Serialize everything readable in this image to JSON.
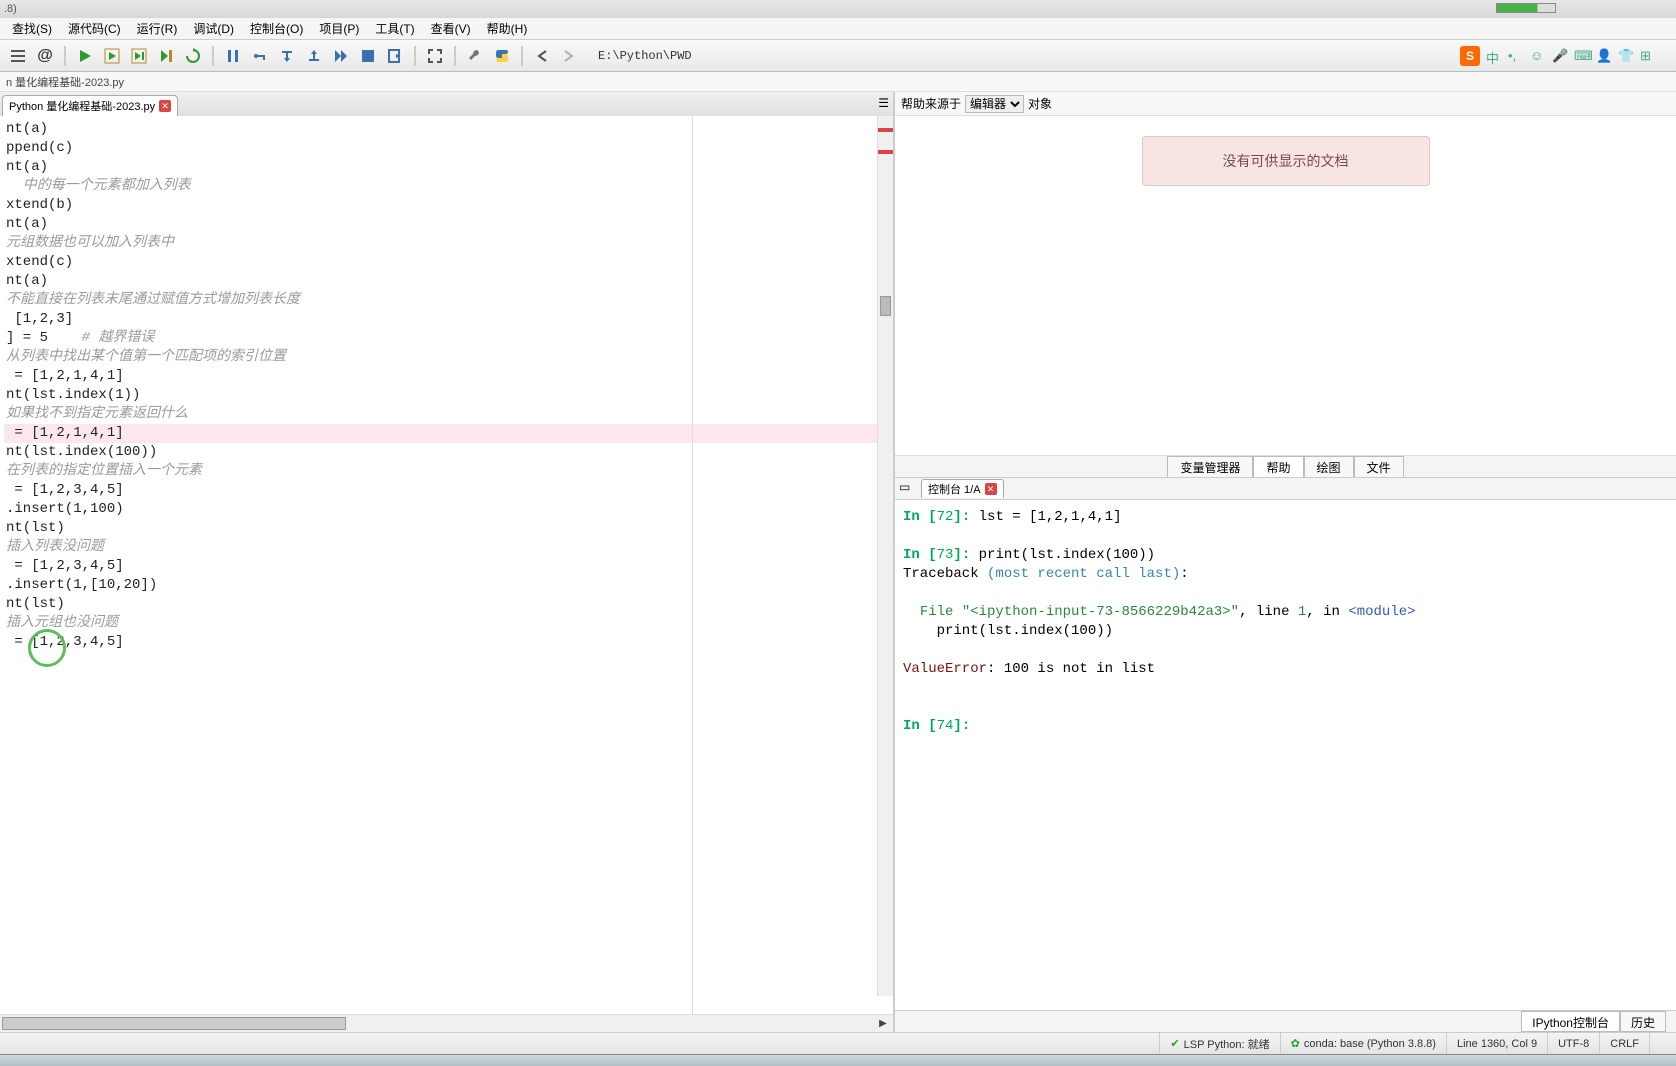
{
  "title_bar": {
    "text": ".8)"
  },
  "menu": [
    "查找(S)",
    "源代码(C)",
    "运行(R)",
    "调试(D)",
    "控制台(O)",
    "项目(P)",
    "工具(T)",
    "查看(V)",
    "帮助(H)"
  ],
  "toolbar": {
    "path": "E:\\Python\\PWD"
  },
  "breadcrumb": "n 量化编程基础-2023.py",
  "tab": {
    "label": "Python 量化编程基础-2023.py"
  },
  "help_bar": {
    "label": "帮助来源于",
    "dropdown": "编辑器",
    "object_label": "对象"
  },
  "no_doc": "没有可供显示的文档",
  "right_tabs": [
    "变量管理器",
    "帮助",
    "绘图",
    "文件"
  ],
  "console_tab": "控制台 1/A",
  "bottom_tabs": [
    "IPython控制台",
    "历史"
  ],
  "code_lines": [
    {
      "t": "nt(a)"
    },
    {
      "t": ""
    },
    {
      "t": "ppend(c)"
    },
    {
      "t": "nt(a)"
    },
    {
      "t": ""
    },
    {
      "t": ""
    },
    {
      "t": "  中的每一个元素都加入列表",
      "c": true
    },
    {
      "t": "xtend(b)"
    },
    {
      "t": "nt(a)"
    },
    {
      "t": ""
    },
    {
      "t": "元组数据也可以加入列表中",
      "c": true
    },
    {
      "t": "xtend(c)"
    },
    {
      "t": "nt(a)"
    },
    {
      "t": ""
    },
    {
      "t": ""
    },
    {
      "t": "不能直接在列表末尾通过赋值方式增加列表长度",
      "c": true
    },
    {
      "t": " [1,2,3]"
    },
    {
      "t": "] = 5    # 越界错误",
      "mix": true
    },
    {
      "t": ""
    },
    {
      "t": ""
    },
    {
      "t": ""
    },
    {
      "t": "从列表中找出某个值第一个匹配项的索引位置",
      "c": true
    },
    {
      "t": " = [1,2,1,4,1]"
    },
    {
      "t": "nt(lst.index(1))"
    },
    {
      "t": ""
    },
    {
      "t": ""
    },
    {
      "t": "如果找不到指定元素返回什么",
      "c": true
    },
    {
      "t": " = [1,2,1,4,1]",
      "hl": true
    },
    {
      "t": "nt(lst.index(100))"
    },
    {
      "t": ""
    },
    {
      "t": ""
    },
    {
      "t": ""
    },
    {
      "t": ""
    },
    {
      "t": "在列表的指定位置插入一个元素",
      "c": true
    },
    {
      "t": " = [1,2,3,4,5]"
    },
    {
      "t": ".insert(1,100)"
    },
    {
      "t": "nt(lst)"
    },
    {
      "t": ""
    },
    {
      "t": "插入列表没问题",
      "c": true
    },
    {
      "t": " = [1,2,3,4,5]"
    },
    {
      "t": ".insert(1,[10,20])"
    },
    {
      "t": "nt(lst)"
    },
    {
      "t": ""
    },
    {
      "t": "插入元组也没问题",
      "c": true
    },
    {
      "t": " = [1,2,3,4,5]"
    }
  ],
  "console_lines": [
    {
      "type": "in",
      "n": "72",
      "cmd": "lst = [1,2,1,4,1]"
    },
    {
      "type": "blank"
    },
    {
      "type": "in",
      "n": "73",
      "cmd": "print(lst.index(100))"
    },
    {
      "type": "trace",
      "text": "Traceback (most recent call last):"
    },
    {
      "type": "blank"
    },
    {
      "type": "file",
      "text": "  File \"<ipython-input-73-8566229b42a3>\", line 1, in <module>"
    },
    {
      "type": "plain",
      "text": "    print(lst.index(100))"
    },
    {
      "type": "blank"
    },
    {
      "type": "err",
      "text": "ValueError: 100 is not in list"
    },
    {
      "type": "blank"
    },
    {
      "type": "blank"
    },
    {
      "type": "in",
      "n": "74",
      "cmd": ""
    }
  ],
  "status": {
    "lsp": "LSP Python: 就绪",
    "conda": "conda: base (Python 3.8.8)",
    "pos": "Line 1360, Col 9",
    "enc": "UTF-8",
    "eol": "CRLF",
    "rw": ""
  }
}
